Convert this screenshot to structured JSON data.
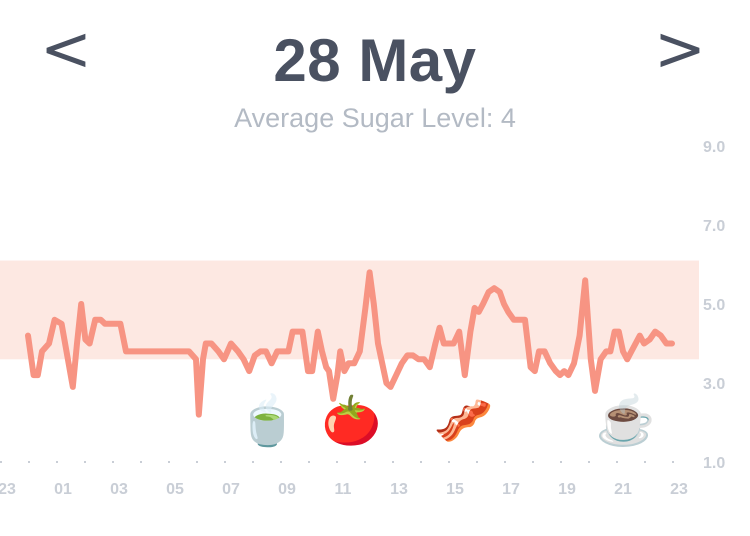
{
  "header": {
    "prev_label": "<",
    "next_label": ">",
    "date": "28 May",
    "average": "Average Sugar Level: 4"
  },
  "chart_data": {
    "type": "line",
    "title": "",
    "xlabel": "",
    "ylabel": "",
    "x_ticks": [
      "23",
      "01",
      "03",
      "05",
      "07",
      "09",
      "11",
      "13",
      "15",
      "17",
      "19",
      "21",
      "23"
    ],
    "y_ticks": [
      "9.0",
      "7.0",
      "5.0",
      "3.0",
      "1.0"
    ],
    "ylim": [
      1,
      9
    ],
    "target_range": [
      3.6,
      6.1
    ],
    "target_band_color": "#fde8e2",
    "line_color": "#f79483",
    "series": [
      {
        "x": [
          0.75,
          0.95,
          1.1,
          1.25,
          1.5,
          1.7,
          1.95,
          2.15,
          2.35,
          2.5,
          2.65,
          2.8,
          2.95,
          3.15,
          3.35,
          3.5,
          3.65,
          3.85,
          4.05,
          4.25,
          4.5,
          4.75,
          5.0,
          5.15,
          5.3,
          5.6,
          5.9,
          6.2,
          6.5,
          6.75,
          6.85,
          7.0,
          7.1,
          7.3,
          7.55,
          7.75,
          8.0,
          8.25,
          8.45,
          8.65,
          8.85,
          9.05,
          9.25,
          9.45,
          9.65,
          9.85,
          10.05,
          10.2,
          10.35,
          10.55,
          10.75,
          10.9,
          11.1,
          11.25,
          11.4,
          11.5,
          11.65,
          11.8,
          11.9,
          12.05,
          12.2,
          12.4,
          12.6,
          12.8,
          12.95,
          13.1,
          13.25,
          13.4,
          13.55,
          13.7,
          13.9,
          14.1,
          14.3,
          14.5,
          14.7,
          14.9,
          15.1,
          15.3,
          15.45,
          15.6,
          15.75,
          15.95,
          16.15,
          16.35,
          16.55,
          16.7,
          16.85,
          17.0,
          17.2,
          17.4,
          17.6,
          17.75,
          17.9,
          18.1,
          18.3,
          18.5,
          18.7,
          18.85,
          19.0,
          19.2,
          19.4,
          19.6,
          19.75,
          19.9,
          20.05,
          20.25,
          20.45,
          20.65,
          20.85,
          21.0,
          21.2,
          21.4,
          21.55,
          21.7,
          21.85,
          22.0,
          22.15,
          22.3,
          22.45,
          22.6,
          22.75,
          22.95,
          23.15,
          23.35,
          23.55,
          23.75
        ],
        "y": [
          4.2,
          3.2,
          3.2,
          3.8,
          4.0,
          4.6,
          4.5,
          3.7,
          2.9,
          4.0,
          5.0,
          4.1,
          4.0,
          4.6,
          4.6,
          4.5,
          4.5,
          4.5,
          4.5,
          3.8,
          3.8,
          3.8,
          3.8,
          3.8,
          3.8,
          3.8,
          3.8,
          3.8,
          3.8,
          3.6,
          2.2,
          3.6,
          4.0,
          4.0,
          3.8,
          3.6,
          4.0,
          3.8,
          3.6,
          3.3,
          3.7,
          3.8,
          3.8,
          3.5,
          3.8,
          3.8,
          3.8,
          4.3,
          4.3,
          4.3,
          3.3,
          3.3,
          4.3,
          3.8,
          3.4,
          3.3,
          2.6,
          3.2,
          3.8,
          3.3,
          3.5,
          3.5,
          3.8,
          4.9,
          5.8,
          5.0,
          4.0,
          3.5,
          3.0,
          2.9,
          3.2,
          3.5,
          3.7,
          3.7,
          3.6,
          3.6,
          3.4,
          4.0,
          4.4,
          4.0,
          4.0,
          4.0,
          4.3,
          3.2,
          4.3,
          4.9,
          4.8,
          5.0,
          5.3,
          5.4,
          5.3,
          5.0,
          4.8,
          4.6,
          4.6,
          4.6,
          3.4,
          3.3,
          3.8,
          3.8,
          3.5,
          3.3,
          3.2,
          3.3,
          3.2,
          3.5,
          4.2,
          5.6,
          3.6,
          2.8,
          3.6,
          3.8,
          3.8,
          4.3,
          4.3,
          3.8,
          3.6,
          3.8,
          4.0,
          4.2,
          4.0,
          4.1,
          4.3,
          4.2,
          4.0,
          4.0
        ]
      }
    ],
    "events": [
      {
        "x": 9.3,
        "icon": "green-tea-icon",
        "glyph": "🍵"
      },
      {
        "x": 12.3,
        "icon": "tomato-icon",
        "glyph": "🍅"
      },
      {
        "x": 16.3,
        "icon": "bacon-bread-icon",
        "glyph": "🥓"
      },
      {
        "x": 22.1,
        "icon": "coffee-icon",
        "glyph": "☕"
      }
    ]
  }
}
